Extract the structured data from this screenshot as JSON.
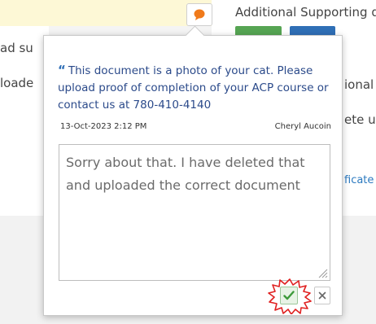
{
  "background": {
    "heading": "Additional Supporting d",
    "left_line1": "ad su",
    "left_line2": "loade",
    "right_line1": "ional",
    "right_line2": "ete u",
    "right_link": "ficate"
  },
  "comment_popup": {
    "previous_comment": {
      "text": "This document is a photo of your cat. Please upload proof of completion of your ACP course or contact us at 780-410-4140",
      "date": "13-Oct-2023 2:12 PM",
      "author": "Cheryl Aucoin"
    },
    "reply_value": "Sorry about that.  I have deleted that and uploaded the correct document",
    "save_icon": "checkmark-icon",
    "cancel_icon": "close-icon"
  },
  "colors": {
    "accent_blue": "#2f6fb6",
    "save_green": "#3d9a3a",
    "highlight_red": "#e02020",
    "comment_orange": "#f07a1a"
  }
}
